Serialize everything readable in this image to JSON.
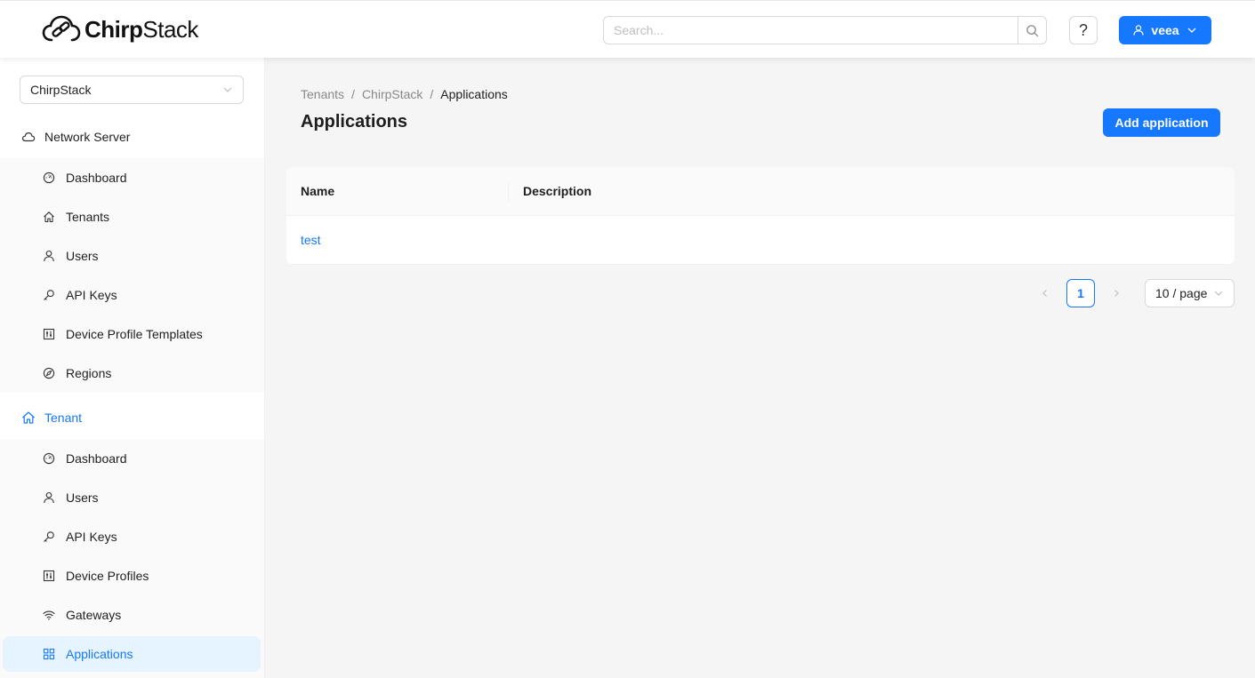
{
  "header": {
    "logo_bold": "Chirp",
    "logo_light": "Stack",
    "search_placeholder": "Search...",
    "help_label": "?",
    "user_label": "veea"
  },
  "sidebar": {
    "tenant_select_value": "ChirpStack",
    "network_server": {
      "label": "Network Server",
      "items": [
        {
          "label": "Dashboard",
          "icon": "dashboard-icon"
        },
        {
          "label": "Tenants",
          "icon": "home-icon"
        },
        {
          "label": "Users",
          "icon": "user-icon"
        },
        {
          "label": "API Keys",
          "icon": "key-icon"
        },
        {
          "label": "Device Profile Templates",
          "icon": "controls-icon"
        },
        {
          "label": "Regions",
          "icon": "compass-icon"
        }
      ]
    },
    "tenant": {
      "label": "Tenant",
      "items": [
        {
          "label": "Dashboard",
          "icon": "dashboard-icon"
        },
        {
          "label": "Users",
          "icon": "user-icon"
        },
        {
          "label": "API Keys",
          "icon": "key-icon"
        },
        {
          "label": "Device Profiles",
          "icon": "controls-icon"
        },
        {
          "label": "Gateways",
          "icon": "wifi-icon"
        },
        {
          "label": "Applications",
          "icon": "appstore-icon"
        }
      ]
    }
  },
  "main": {
    "breadcrumb": [
      "Tenants",
      "ChirpStack",
      "Applications"
    ],
    "title": "Applications",
    "add_button": "Add application",
    "table": {
      "columns": [
        "Name",
        "Description"
      ],
      "rows": [
        {
          "name": "test",
          "description": ""
        }
      ]
    },
    "pagination": {
      "current_page": "1",
      "page_size": "10 / page"
    }
  },
  "colors": {
    "accent": "#1677ff",
    "selected_bg": "#e6f4ff"
  }
}
